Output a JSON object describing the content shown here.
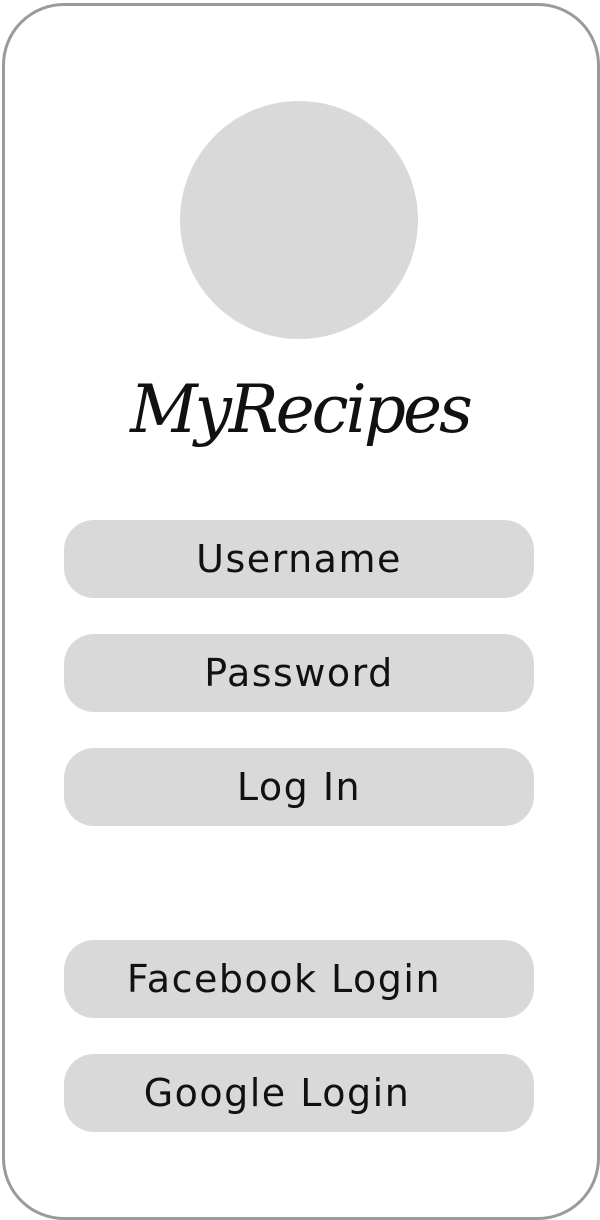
{
  "app": {
    "title": "MyRecipes"
  },
  "login_form": {
    "username_placeholder": "Username",
    "password_placeholder": "Password",
    "login_label": "Log In"
  },
  "social_login": {
    "facebook_label": "Facebook Login",
    "google_label": "Google Login"
  },
  "colors": {
    "frame_border": "#9a9a9a",
    "placeholder_fill": "#d9d9d9",
    "text": "#111111",
    "background": "#ffffff"
  }
}
